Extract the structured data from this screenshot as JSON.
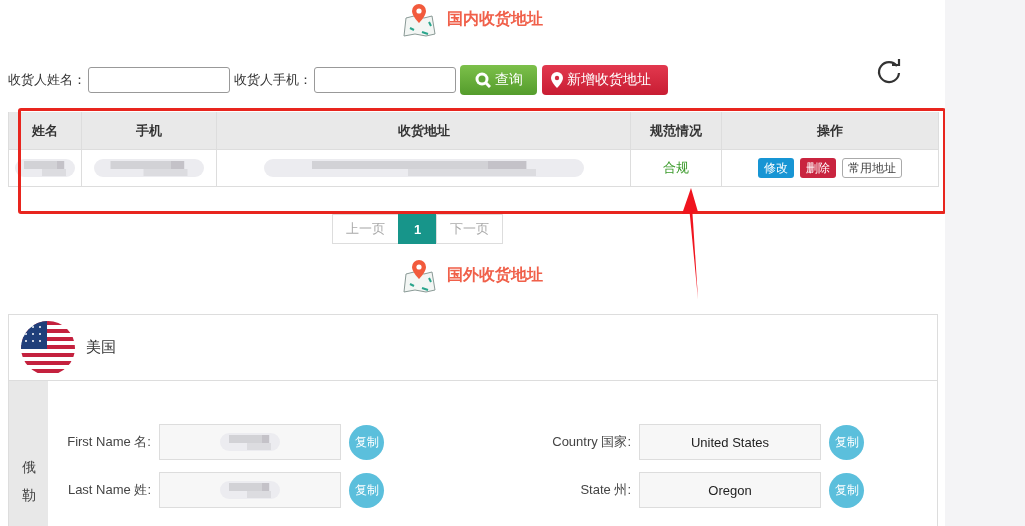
{
  "domestic": {
    "title": "国内收货地址",
    "search": {
      "fields": [
        {
          "label": "收货人姓名："
        },
        {
          "label": "收货人手机："
        }
      ],
      "buttons": [
        {
          "label": "查询",
          "kind": "search"
        },
        {
          "label": "新增收货地址",
          "kind": "add"
        }
      ]
    },
    "table": {
      "columns": [
        "姓名",
        "手机",
        "收货地址",
        "规范情况",
        "操作"
      ],
      "rows": [
        {
          "status": "合规",
          "actions": [
            {
              "label": "修改",
              "kind": "edit"
            },
            {
              "label": "删除",
              "kind": "delete"
            },
            {
              "label": "常用地址",
              "kind": "default"
            }
          ]
        }
      ]
    },
    "pagination": [
      {
        "label": "上一页",
        "selected": false,
        "disabled": true
      },
      {
        "label": "1",
        "selected": true,
        "disabled": false
      },
      {
        "label": "下一页",
        "selected": false,
        "disabled": true
      }
    ]
  },
  "foreign": {
    "title": "国外收货地址",
    "card": {
      "country": "美国",
      "region": "俄勒",
      "fields": [
        {
          "label": "First Name 名:",
          "copy": "复制"
        },
        {
          "label": "Country 国家:",
          "value": "United States",
          "copy": "复制"
        },
        {
          "label": "Last Name 姓:",
          "copy": "复制"
        },
        {
          "label": "State 州:",
          "value": "Oregon",
          "copy": "复制"
        }
      ]
    }
  },
  "annotations": [
    {
      "kind": "frame"
    },
    {
      "kind": "arrow"
    }
  ]
}
